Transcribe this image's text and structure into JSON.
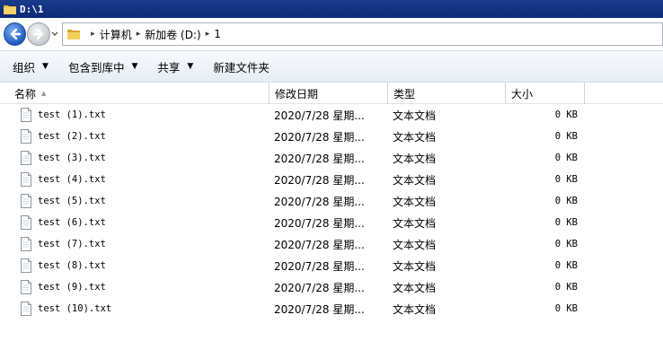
{
  "window": {
    "title": "D:\\1"
  },
  "address": {
    "crumbs": [
      "计算机",
      "新加卷 (D:)",
      "1"
    ]
  },
  "commands": [
    {
      "label": "组织",
      "has_menu": true
    },
    {
      "label": "包含到库中",
      "has_menu": true
    },
    {
      "label": "共享",
      "has_menu": true
    },
    {
      "label": "新建文件夹",
      "has_menu": false
    }
  ],
  "columns": {
    "name": "名称",
    "date": "修改日期",
    "type": "类型",
    "size": "大小"
  },
  "files": [
    {
      "name": "test (1).txt",
      "date": "2020/7/28 星期...",
      "type": "文本文档",
      "size": "0 KB"
    },
    {
      "name": "test (2).txt",
      "date": "2020/7/28 星期...",
      "type": "文本文档",
      "size": "0 KB"
    },
    {
      "name": "test (3).txt",
      "date": "2020/7/28 星期...",
      "type": "文本文档",
      "size": "0 KB"
    },
    {
      "name": "test (4).txt",
      "date": "2020/7/28 星期...",
      "type": "文本文档",
      "size": "0 KB"
    },
    {
      "name": "test (5).txt",
      "date": "2020/7/28 星期...",
      "type": "文本文档",
      "size": "0 KB"
    },
    {
      "name": "test (6).txt",
      "date": "2020/7/28 星期...",
      "type": "文本文档",
      "size": "0 KB"
    },
    {
      "name": "test (7).txt",
      "date": "2020/7/28 星期...",
      "type": "文本文档",
      "size": "0 KB"
    },
    {
      "name": "test (8).txt",
      "date": "2020/7/28 星期...",
      "type": "文本文档",
      "size": "0 KB"
    },
    {
      "name": "test (9).txt",
      "date": "2020/7/28 星期...",
      "type": "文本文档",
      "size": "0 KB"
    },
    {
      "name": "test (10).txt",
      "date": "2020/7/28 星期...",
      "type": "文本文档",
      "size": "0 KB"
    }
  ],
  "icons": {
    "window": "folder-icon",
    "back": "back-arrow-icon",
    "forward": "forward-arrow-icon",
    "file": "text-file-icon"
  },
  "colors": {
    "titlebar": "#0c2a78",
    "back_button": "#1f5bbf",
    "cmdbar": "#e7edf6"
  }
}
